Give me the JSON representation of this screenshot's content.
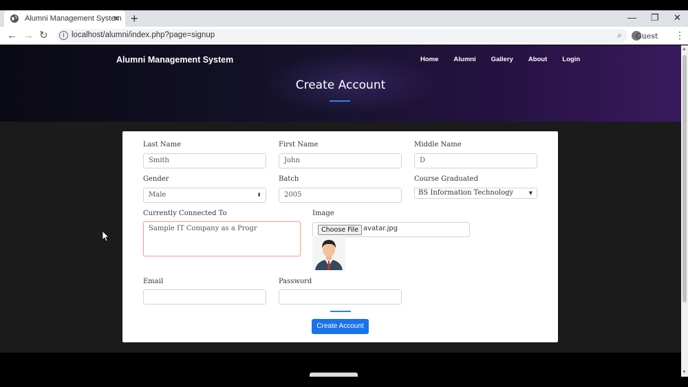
{
  "browser": {
    "tab_title": "Alumni Management System",
    "url": "localhost/alumni/index.php?page=signup",
    "profile_label": "Guest"
  },
  "site": {
    "brand": "Alumni Management System",
    "nav": [
      "Home",
      "Alumni",
      "Gallery",
      "About",
      "Login"
    ],
    "page_title": "Create Account"
  },
  "form": {
    "last_name": {
      "label": "Last Name",
      "value": "Smith"
    },
    "first_name": {
      "label": "First Name",
      "value": "John"
    },
    "middle_name": {
      "label": "Middle Name",
      "value": "D"
    },
    "gender": {
      "label": "Gender",
      "value": "Male"
    },
    "batch": {
      "label": "Batch",
      "value": "2005"
    },
    "course": {
      "label": "Course Graduated",
      "value": "BS Information Technology"
    },
    "connected_to": {
      "label": "Currently Connected To",
      "value": "Sample IT Company as a Progr"
    },
    "image": {
      "label": "Image",
      "button": "Choose File",
      "filename": "avatar.jpg"
    },
    "email": {
      "label": "Email",
      "value": ""
    },
    "password": {
      "label": "Password",
      "value": ""
    },
    "submit_label": "Create Account"
  },
  "colors": {
    "accent": "#1a73e8",
    "textarea_focus_border": "#f0a89a",
    "page_background": "#1b1b1b"
  }
}
